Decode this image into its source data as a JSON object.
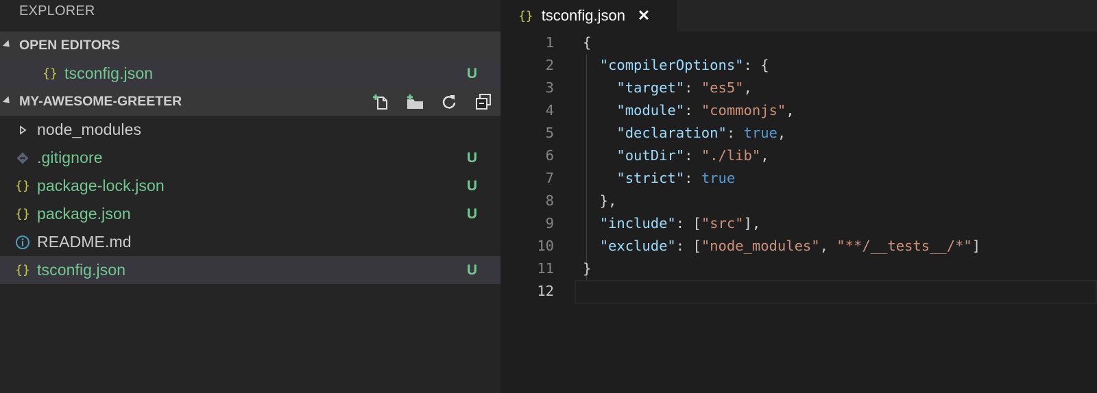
{
  "sidebar": {
    "title": "EXPLORER",
    "open_editors": {
      "header": "OPEN EDITORS",
      "items": [
        {
          "icon": "{}",
          "label": "tsconfig.json",
          "badge": "U"
        }
      ]
    },
    "project": {
      "header": "MY-AWESOME-GREETER",
      "actions": [
        "new-file-icon",
        "new-folder-icon",
        "refresh-icon",
        "collapse-all-icon"
      ],
      "items": [
        {
          "icon": "chevron-right-icon",
          "label": "node_modules",
          "badge": ""
        },
        {
          "icon": "git-icon",
          "label": ".gitignore",
          "badge": "U"
        },
        {
          "icon": "{}",
          "label": "package-lock.json",
          "badge": "U"
        },
        {
          "icon": "{}",
          "label": "package.json",
          "badge": "U"
        },
        {
          "icon": "info-icon",
          "label": "README.md",
          "badge": ""
        },
        {
          "icon": "{}",
          "label": "tsconfig.json",
          "badge": "U"
        }
      ]
    }
  },
  "editor": {
    "tab": {
      "icon": "{}",
      "label": "tsconfig.json",
      "close": "✕"
    },
    "lines": [
      {
        "n": "1",
        "text": "{"
      },
      {
        "n": "2",
        "text": "  \"compilerOptions\": {"
      },
      {
        "n": "3",
        "text": "    \"target\": \"es5\","
      },
      {
        "n": "4",
        "text": "    \"module\": \"commonjs\","
      },
      {
        "n": "5",
        "text": "    \"declaration\": true,"
      },
      {
        "n": "6",
        "text": "    \"outDir\": \"./lib\","
      },
      {
        "n": "7",
        "text": "    \"strict\": true"
      },
      {
        "n": "8",
        "text": "  },"
      },
      {
        "n": "9",
        "text": "  \"include\": [\"src\"],"
      },
      {
        "n": "10",
        "text": "  \"exclude\": [\"node_modules\", \"**/__tests__/*\"]"
      },
      {
        "n": "11",
        "text": "}"
      },
      {
        "n": "12",
        "text": ""
      }
    ]
  },
  "colors": {
    "untracked": "#73c991",
    "json_icon": "#cbcb41",
    "info_icon": "#519aba",
    "key": "#9cdcfe",
    "string": "#ce9178",
    "keyword": "#569cd6"
  }
}
